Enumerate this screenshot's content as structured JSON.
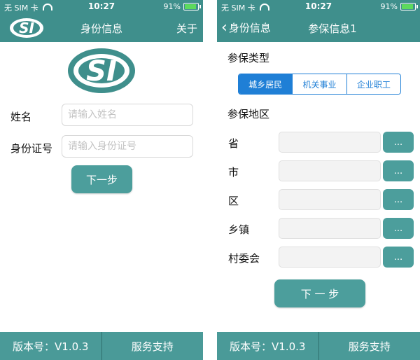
{
  "status": {
    "carrier": "无 SIM 卡",
    "time": "10:27",
    "battery": "91%"
  },
  "colors": {
    "nav": "#3f8f8c",
    "button": "#4c9e9c",
    "footer": "#4a9a98",
    "segment": "#1f7fd6"
  },
  "left": {
    "nav": {
      "title": "身份信息",
      "right": "关于"
    },
    "logo_text": "SI",
    "form": {
      "name_label": "姓名",
      "name_placeholder": "请输入姓名",
      "id_label": "身份证号",
      "id_placeholder": "请输入身份证号"
    },
    "next_label": "下一步"
  },
  "right": {
    "nav": {
      "back": "身份信息",
      "title": "参保信息1"
    },
    "type_label": "参保类型",
    "segments": [
      "城乡居民",
      "机关事业",
      "企业职工"
    ],
    "segment_selected": "城乡居民",
    "region_label": "参保地区",
    "rows": [
      {
        "label": "省",
        "button": "..."
      },
      {
        "label": "市",
        "button": "..."
      },
      {
        "label": "区",
        "button": "..."
      },
      {
        "label": "乡镇",
        "button": "..."
      },
      {
        "label": "村委会",
        "button": "..."
      }
    ],
    "next_label": "下 一 步"
  },
  "footer": {
    "version": "版本号：V1.0.3",
    "support": "服务支持"
  }
}
